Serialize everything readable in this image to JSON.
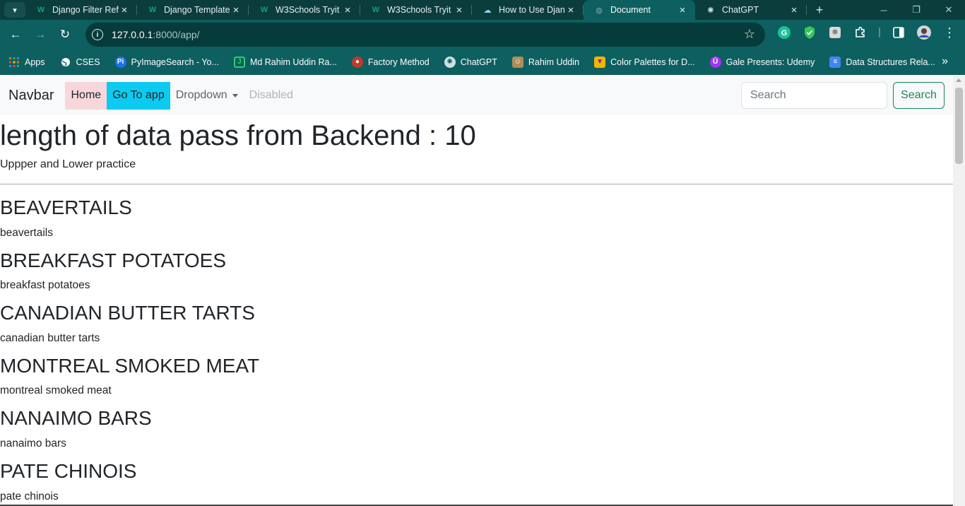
{
  "browser": {
    "tabs": [
      {
        "label": "Django Filter Ref",
        "favicon": "W",
        "favicon_color": "#04aa6d",
        "active": false
      },
      {
        "label": "Django Template",
        "favicon": "W",
        "favicon_color": "#04aa6d",
        "active": false
      },
      {
        "label": "W3Schools Tryit",
        "favicon": "W",
        "favicon_color": "#04aa6d",
        "active": false
      },
      {
        "label": "W3Schools Tryit",
        "favicon": "W",
        "favicon_color": "#04aa6d",
        "active": false
      },
      {
        "label": "How to Use Djan",
        "favicon": "☁",
        "favicon_color": "#8fd3f0",
        "active": false
      },
      {
        "label": "Document",
        "favicon": "◍",
        "favicon_color": "#8aa3a3",
        "active": true
      },
      {
        "label": "ChatGPT",
        "favicon": "✺",
        "favicon_color": "#cfe0df",
        "active": false
      }
    ],
    "address": {
      "host": "127.0.0.1",
      "path": ":8000/app/"
    },
    "bookmarks": [
      {
        "label": "Apps",
        "icon": "apps-grid-icon",
        "color": "#e8710a"
      },
      {
        "label": "CSES",
        "icon": "globe-icon",
        "color": "#ffffff"
      },
      {
        "label": "PyImageSearch - Yo...",
        "icon": "pyimagesearch-icon",
        "color": "#1a73e8"
      },
      {
        "label": "Md Rahim Uddin Ra...",
        "icon": "leetcode-icon",
        "color": "#2ecc71"
      },
      {
        "label": "Factory Method",
        "icon": "refactoring-icon",
        "color": "#c0392b"
      },
      {
        "label": "ChatGPT",
        "icon": "chatgpt-icon",
        "color": "#cfe0df"
      },
      {
        "label": "Rahim Uddin",
        "icon": "avatar-icon",
        "color": "#b08d57"
      },
      {
        "label": "Color Palettes for D...",
        "icon": "palette-icon",
        "color": "#f4b400"
      },
      {
        "label": "Gale Presents: Udemy",
        "icon": "udemy-icon",
        "color": "#a435f0"
      },
      {
        "label": "Data Structures Rela...",
        "icon": "docs-icon",
        "color": "#4285f4"
      }
    ]
  },
  "navbar": {
    "brand": "Navbar",
    "links": {
      "home": "Home",
      "app": "Go To app",
      "dropdown": "Dropdown",
      "disabled": "Disabled"
    },
    "search_placeholder": "Search",
    "search_button": "Search"
  },
  "page": {
    "heading": "length of data pass from Backend : 10",
    "subtitle": "Uppper and Lower practice",
    "items": [
      {
        "upper": "BEAVERTAILS",
        "lower": "beavertails"
      },
      {
        "upper": "BREAKFAST POTATOES",
        "lower": "breakfast potatoes"
      },
      {
        "upper": "CANADIAN BUTTER TARTS",
        "lower": "canadian butter tarts"
      },
      {
        "upper": "MONTREAL SMOKED MEAT",
        "lower": "montreal smoked meat"
      },
      {
        "upper": "NANAIMO BARS",
        "lower": "nanaimo bars"
      },
      {
        "upper": "PATE CHINOIS",
        "lower": "pate chinois"
      }
    ]
  }
}
